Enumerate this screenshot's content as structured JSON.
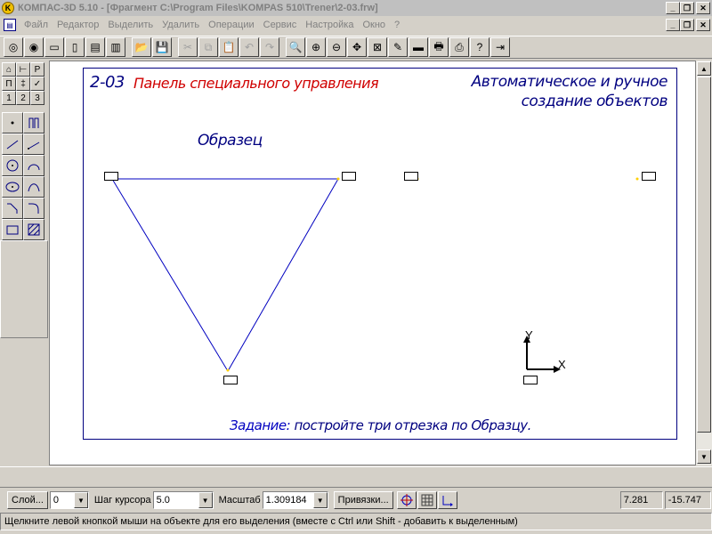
{
  "window": {
    "app_icon": "kompas-logo-icon",
    "title": "КОМПАС-3D 5.10 - [Фрагмент C:\\Program Files\\KOMPAS 510\\Trener\\2-03.frw]"
  },
  "menu": {
    "items": [
      "Файл",
      "Редактор",
      "Выделить",
      "Удалить",
      "Операции",
      "Сервис",
      "Настройка",
      "Окно",
      "?"
    ]
  },
  "drawing": {
    "code": "2-03",
    "panel_title": "Панель специального управления",
    "right_title_line1": "Автоматическое и ручное",
    "right_title_line2": "создание объектов",
    "sample_label": "Образец",
    "task_label": "Задание:",
    "task_text": "постройте три отрезка по Образцу.",
    "axis_y": "Y",
    "axis_x": "X"
  },
  "left_tabs": [
    "⌂",
    "⊢",
    "P",
    "П",
    "‡",
    "✓",
    "1",
    "2",
    "3"
  ],
  "statusbar": {
    "layer_button": "Слой...",
    "layer_value": "0",
    "step_label": "Шаг курсора",
    "step_value": "5.0",
    "scale_label": "Масштаб",
    "scale_value": "1.309184",
    "snap_button": "Привязки...",
    "coord_x": "7.281",
    "coord_y": "-15.747"
  },
  "hint": "Щелкните левой кнопкой мыши на объекте для его выделения (вместе с Ctrl или Shift - добавить к выделенным)",
  "colors": {
    "frame": "#000080",
    "accent_red": "#d00000",
    "line": "#0000c0",
    "marker_point": "#ffd000"
  }
}
